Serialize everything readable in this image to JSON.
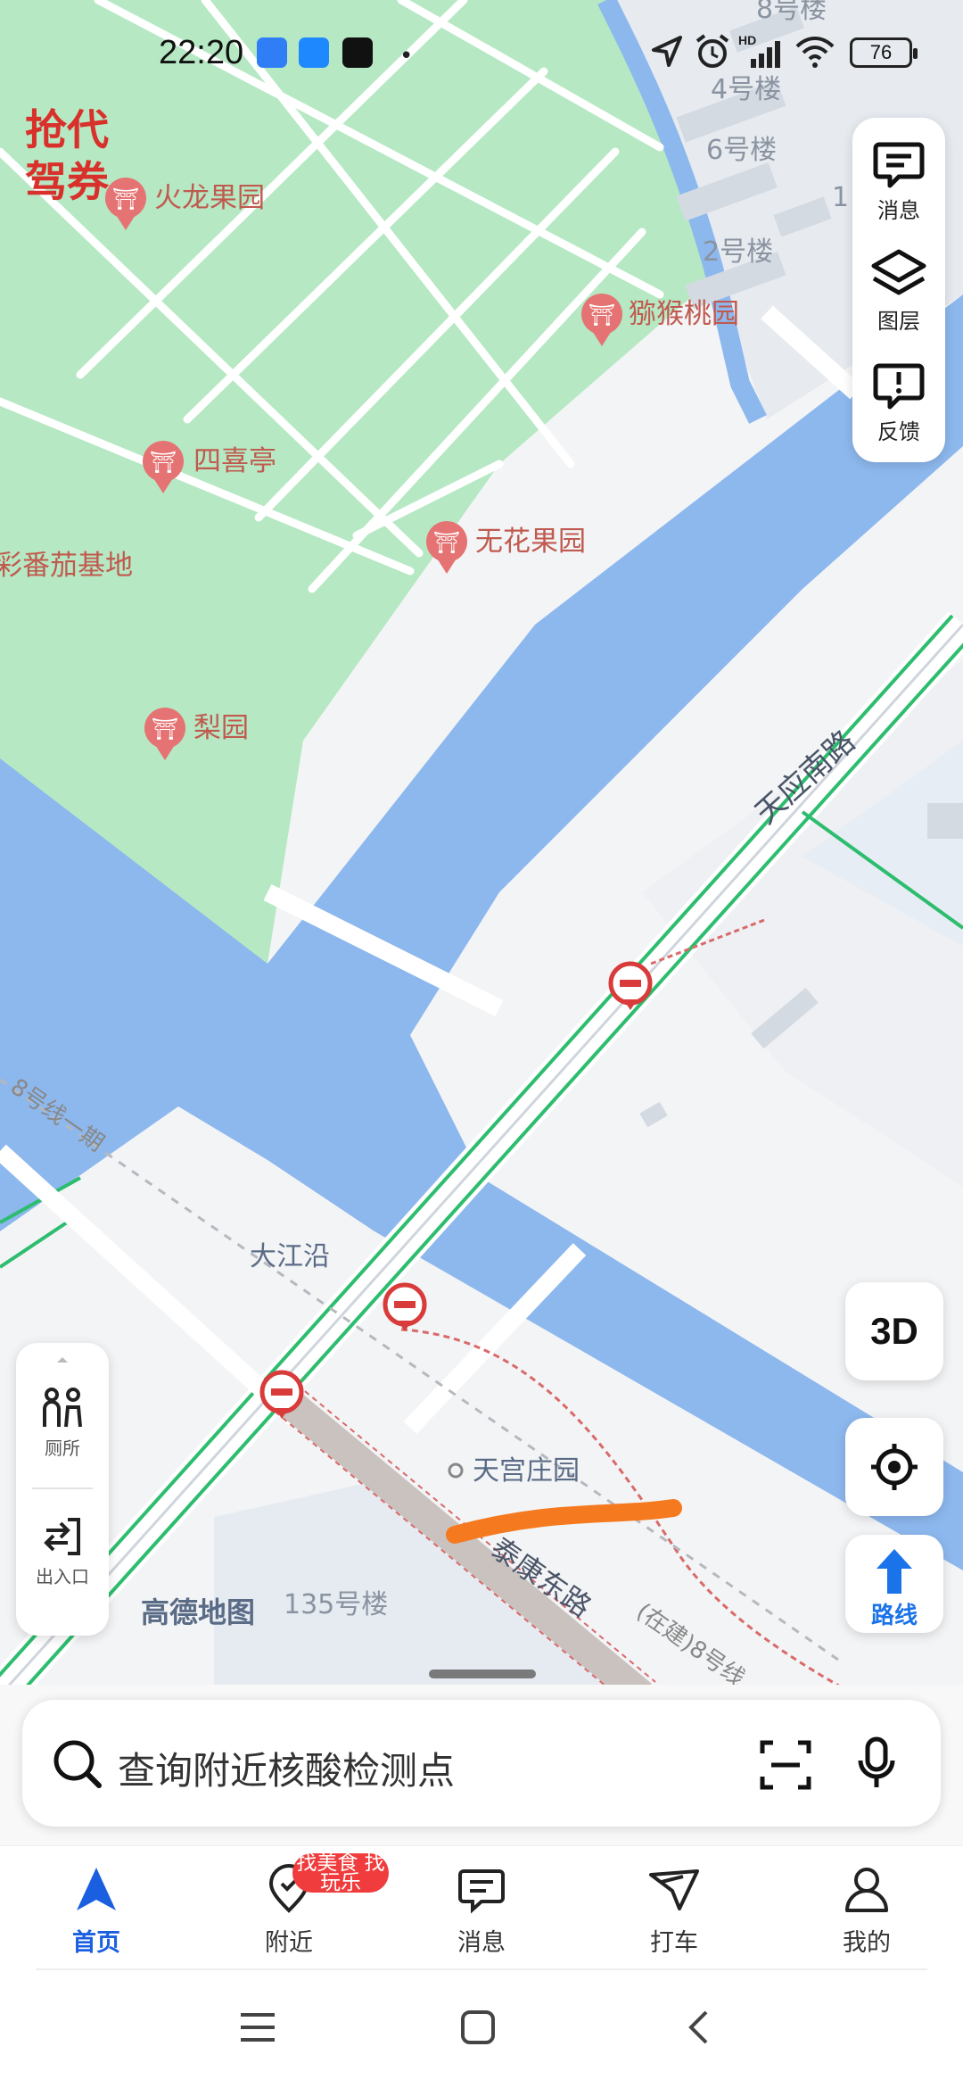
{
  "status_bar": {
    "time": "22:20",
    "battery": "76",
    "network": "HD",
    "icons": [
      "alipay-shield-icon",
      "feishu-icon",
      "tiktok-icon",
      "location-arrow-icon",
      "alarm-icon",
      "signal-icon",
      "wifi-icon",
      "battery-icon"
    ]
  },
  "promo": {
    "line1": "抢代",
    "line2": "驾券"
  },
  "map_labels": {
    "huolong": "火龙果园",
    "mihoutao": "猕猴桃园",
    "sixi": "四喜亭",
    "wuhuaguo": "无花果园",
    "fanqie": "彩番茄基地",
    "liyuan": "梨园",
    "tianying_road": "天应南路",
    "dajiangyan": "大江沿",
    "tiangong": "天宫庄园",
    "taikang_road": "泰康东路",
    "line8_upper": "8号线一期",
    "line8_lower": "(在建)8号线",
    "b135": "135号楼",
    "logo": "高德地图",
    "b8": "8号楼",
    "b4": "4号楼",
    "b6": "6号楼",
    "b2": "2号楼",
    "b1": "1",
    "road_tianying_left": "天应"
  },
  "right_panel": {
    "messages": "消息",
    "layers": "图层",
    "feedback": "反馈"
  },
  "left_panel": {
    "toilet": "厕所",
    "entrance": "出入口"
  },
  "map_controls": {
    "three_d": "3D",
    "route": "路线"
  },
  "search": {
    "placeholder": "查询附近核酸检测点"
  },
  "tabs": [
    {
      "label": "首页",
      "active": true
    },
    {
      "label": "附近",
      "badge": "找美食 找玩乐"
    },
    {
      "label": "消息"
    },
    {
      "label": "打车"
    },
    {
      "label": "我的"
    }
  ],
  "colors": {
    "water": "#8db8ee",
    "park": "#b6e8c3",
    "accent": "#1a5fe0",
    "promo": "#d8312b",
    "route_green": "#2dbd6e"
  }
}
